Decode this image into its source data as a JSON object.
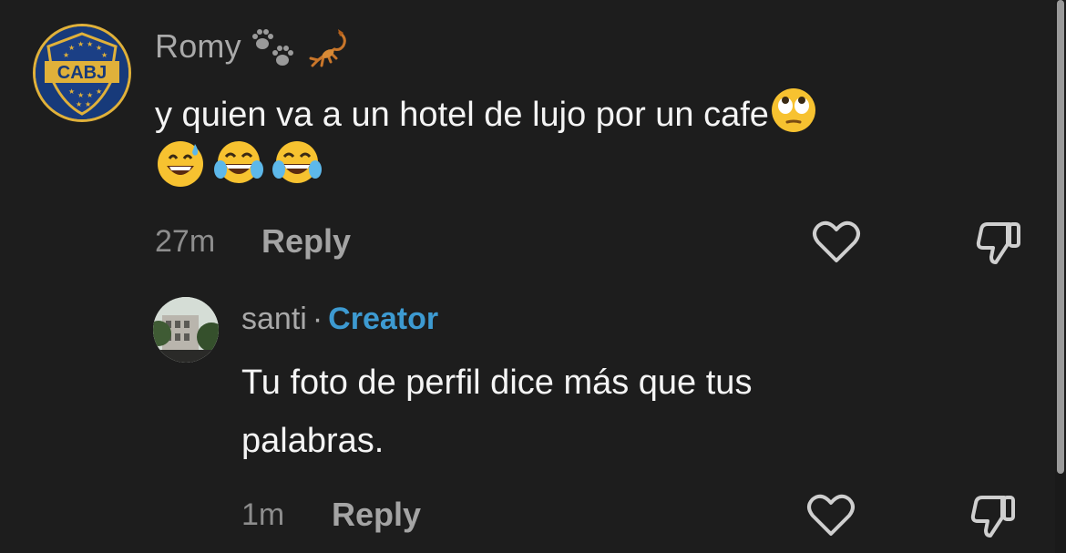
{
  "comments": [
    {
      "username": "Romy",
      "avatar_text": "CABJ",
      "text": "y quien va a un hotel de lujo por un cafe",
      "time": "27m",
      "reply_label": "Reply"
    }
  ],
  "reply": {
    "username": "santi",
    "separator": "·",
    "badge": "Creator",
    "text_line1": "Tu foto de perfil dice más que tus",
    "text_line2": "palabras.",
    "time": "1m",
    "reply_label": "Reply"
  },
  "icons": {
    "name_emojis": [
      "paw-prints-icon",
      "scorpion-icon"
    ],
    "inline_emoji": "face-with-rolling-eyes-icon",
    "emoji_row": [
      "grinning-face-with-sweat-icon",
      "face-with-tears-of-joy-icon",
      "face-with-tears-of-joy-icon"
    ],
    "like": "heart-outline-icon",
    "dislike": "thumbs-down-outline-icon"
  },
  "colors": {
    "background": "#1d1d1d",
    "creator_badge": "#3d9ad1",
    "avatar_gold": "#e0b13a",
    "avatar_blue": "#143064"
  }
}
